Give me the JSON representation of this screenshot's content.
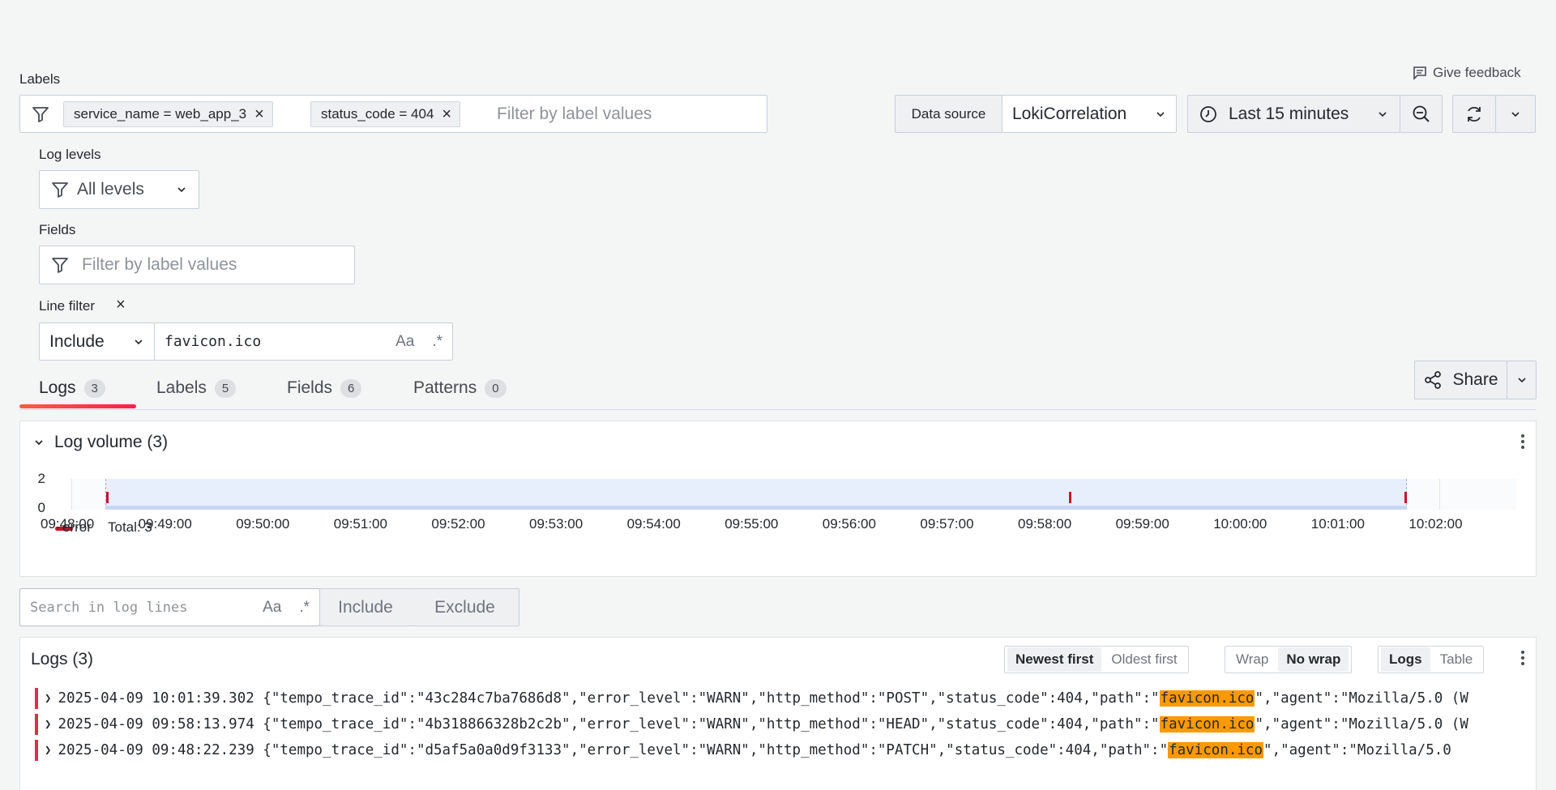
{
  "header": {
    "labels_title": "Labels",
    "feedback": "Give feedback"
  },
  "filters": {
    "chips": [
      {
        "text": "service_name = web_app_3"
      },
      {
        "text": "status_code = 404"
      }
    ],
    "label_placeholder": "Filter by label values"
  },
  "datasource": {
    "label": "Data source",
    "value": "LokiCorrelation"
  },
  "time": {
    "range": "Last 15 minutes"
  },
  "log_levels": {
    "title": "Log levels",
    "value": "All levels"
  },
  "fields": {
    "title": "Fields",
    "placeholder": "Filter by label values"
  },
  "line_filter": {
    "title": "Line filter",
    "close": "×",
    "mode": "Include",
    "value": "favicon.ico",
    "case_toggle": "Aa",
    "regex_toggle": ".*"
  },
  "share": {
    "label": "Share"
  },
  "tabs": [
    {
      "label": "Logs",
      "count": "3"
    },
    {
      "label": "Labels",
      "count": "5"
    },
    {
      "label": "Fields",
      "count": "6"
    },
    {
      "label": "Patterns",
      "count": "0"
    }
  ],
  "volume": {
    "title": "Log volume (3)",
    "legend_label": "error",
    "legend_total": "Total: 3"
  },
  "chart_data": {
    "type": "bar",
    "title": "Log volume (3)",
    "xlabel": "",
    "ylabel": "",
    "ylim": [
      0,
      2
    ],
    "yticks": [
      "2",
      "0"
    ],
    "x_ticks": [
      "09:48:00",
      "09:49:00",
      "09:50:00",
      "09:51:00",
      "09:52:00",
      "09:53:00",
      "09:54:00",
      "09:55:00",
      "09:56:00",
      "09:57:00",
      "09:58:00",
      "09:59:00",
      "10:00:00",
      "10:01:00",
      "10:02:00"
    ],
    "series": [
      {
        "name": "error",
        "color": "#c4162a",
        "points": [
          {
            "time": "09:48:22",
            "value": 1
          },
          {
            "time": "09:58:13",
            "value": 1
          },
          {
            "time": "10:01:39",
            "value": 1
          }
        ]
      }
    ],
    "selected_range": [
      "09:48:22",
      "10:01:39"
    ]
  },
  "search": {
    "placeholder": "Search in log lines",
    "case_toggle": "Aa",
    "regex_toggle": ".*",
    "include": "Include",
    "exclude": "Exclude"
  },
  "logs": {
    "title": "Logs (3)",
    "sort": {
      "newest": "Newest first",
      "oldest": "Oldest first"
    },
    "wrap": {
      "wrap": "Wrap",
      "nowrap": "No wrap"
    },
    "view": {
      "logs": "Logs",
      "table": "Table"
    },
    "lines": [
      {
        "ts": "2025-04-09 10:01:39.302",
        "pre": " {\"tempo_trace_id\":\"43c284c7ba7686d8\",\"error_level\":\"WARN\",\"http_method\":\"POST\",\"status_code\":404,\"path\":\"",
        "match": "favicon.ico",
        "post": "\",\"agent\":\"Mozilla/5.0 (W"
      },
      {
        "ts": "2025-04-09 09:58:13.974",
        "pre": " {\"tempo_trace_id\":\"4b318866328b2c2b\",\"error_level\":\"WARN\",\"http_method\":\"HEAD\",\"status_code\":404,\"path\":\"",
        "match": "favicon.ico",
        "post": "\",\"agent\":\"Mozilla/5.0 (W"
      },
      {
        "ts": "2025-04-09 09:48:22.239",
        "pre": " {\"tempo_trace_id\":\"d5af5a0a0d9f3133\",\"error_level\":\"WARN\",\"http_method\":\"PATCH\",\"status_code\":404,\"path\":\"",
        "match": "favicon.ico",
        "post": "\",\"agent\":\"Mozilla/5.0"
      }
    ]
  },
  "colors": {
    "accent_gradient_start": "#f55f3e",
    "accent_gradient_end": "#ff1f4d",
    "error": "#c4162a",
    "highlight": "#ff9900",
    "range_fill": "#e8effc"
  }
}
